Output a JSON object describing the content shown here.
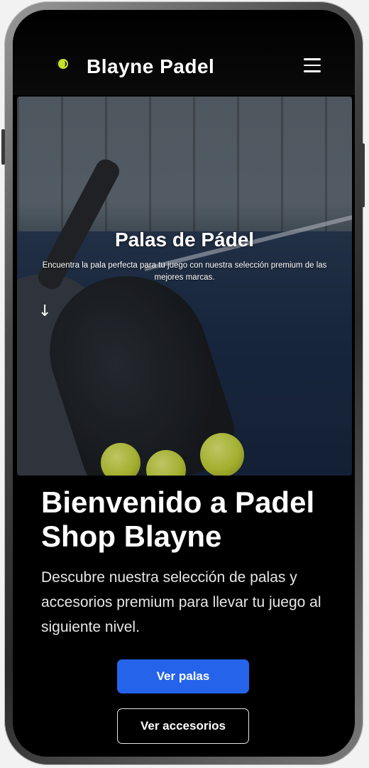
{
  "header": {
    "brand": "Blayne Padel",
    "logo_icon": "padel-ball-icon",
    "menu_icon": "hamburger-menu-icon"
  },
  "hero": {
    "title": "Palas de Pádel",
    "subtitle": "Encuentra la pala perfecta para tu juego con nuestra selección premium de las mejores marcas.",
    "scroll_icon": "arrow-down-icon",
    "scroll_glyph": "↓"
  },
  "welcome": {
    "title": "Bienvenido a Padel Shop Blayne",
    "text": "Descubre nuestra selección de palas y accesorios premium para llevar tu juego al siguiente nivel."
  },
  "buttons": {
    "primary_label": "Ver palas",
    "secondary_label": "Ver accesorios"
  },
  "colors": {
    "accent": "#2563eb",
    "background": "#000000",
    "logo": "#c6e22a"
  }
}
